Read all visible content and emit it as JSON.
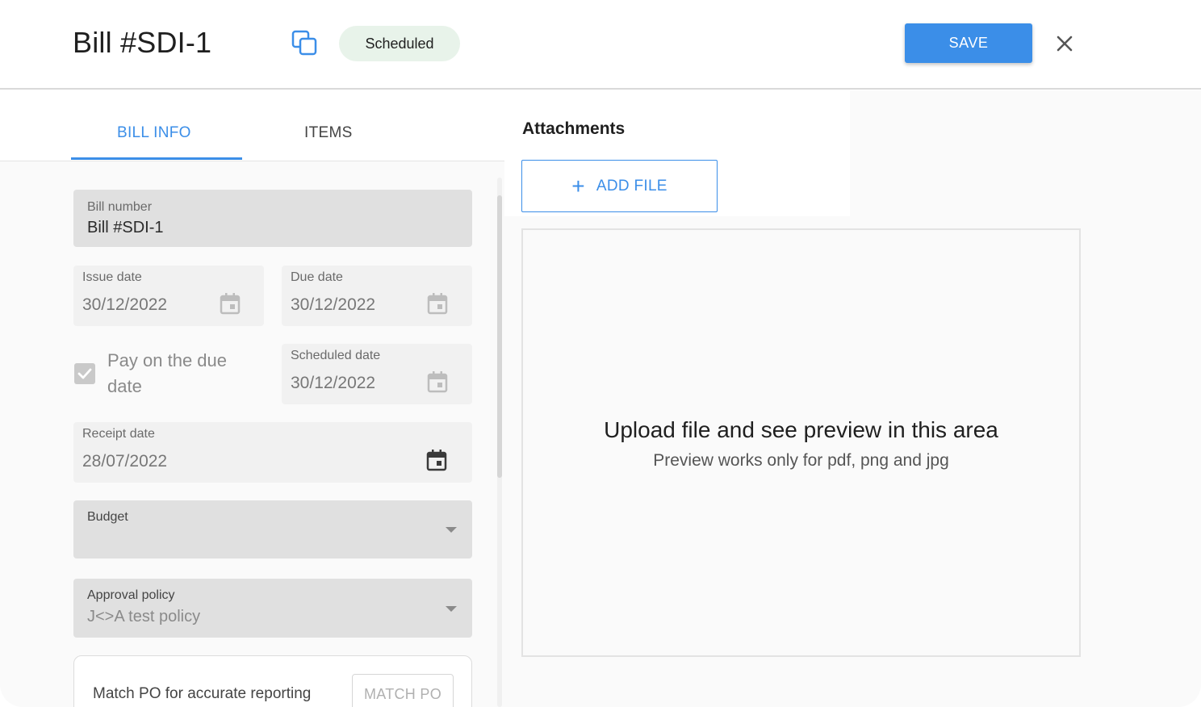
{
  "header": {
    "title": "Bill #SDI-1",
    "status": "Scheduled",
    "save_label": "SAVE",
    "icons": {
      "copy": "copy-icon",
      "close": "close-icon"
    }
  },
  "tabs": [
    {
      "label": "BILL INFO",
      "active": true
    },
    {
      "label": "ITEMS",
      "active": false
    }
  ],
  "form": {
    "bill_number": {
      "label": "Bill number",
      "value": "Bill #SDI-1"
    },
    "issue_date": {
      "label": "Issue date",
      "value": "30/12/2022"
    },
    "due_date": {
      "label": "Due date",
      "value": "30/12/2022"
    },
    "pay_on_due": {
      "label": "Pay on the due date",
      "checked": true
    },
    "scheduled_date": {
      "label": "Scheduled date",
      "value": "30/12/2022"
    },
    "receipt_date": {
      "label": "Receipt date",
      "value": "28/07/2022"
    },
    "budget": {
      "label": "Budget",
      "value": ""
    },
    "approval_policy": {
      "label": "Approval policy",
      "value": "J<>A test policy"
    },
    "match_po": {
      "text": "Match PO for accurate reporting",
      "button": "MATCH PO"
    }
  },
  "attachments": {
    "title": "Attachments",
    "add_file_label": "ADD FILE",
    "preview_title": "Upload file and see preview in this area",
    "preview_subtitle": "Preview works only for pdf, png and jpg"
  },
  "colors": {
    "accent": "#3b8ee8",
    "status_chip_bg": "#e8f3ea",
    "field_bg": "#e0e0e0"
  }
}
